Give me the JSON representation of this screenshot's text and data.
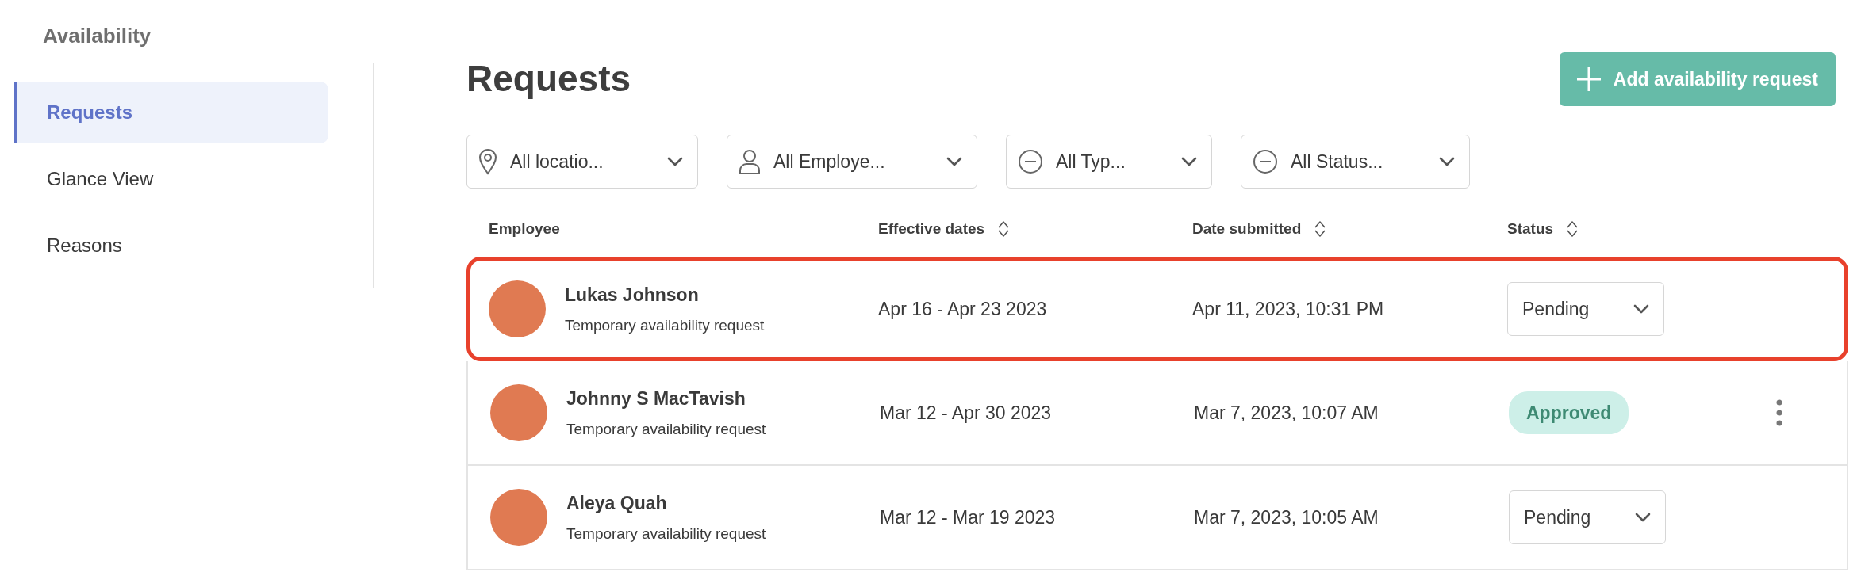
{
  "sidebar": {
    "title": "Availability",
    "items": [
      {
        "label": "Requests",
        "selected": true
      },
      {
        "label": "Glance View",
        "selected": false
      },
      {
        "label": "Reasons",
        "selected": false
      }
    ]
  },
  "header": {
    "title": "Requests",
    "add_button": "Add availability request"
  },
  "filters": [
    {
      "kind": "location",
      "label": "All locatio..."
    },
    {
      "kind": "person",
      "label": "All Employe..."
    },
    {
      "kind": "minus",
      "label": "All Typ..."
    },
    {
      "kind": "minus",
      "label": "All Status..."
    }
  ],
  "table": {
    "columns": [
      {
        "label": "Employee",
        "sortable": false
      },
      {
        "label": "Effective dates",
        "sortable": true
      },
      {
        "label": "Date submitted",
        "sortable": true
      },
      {
        "label": "Status",
        "sortable": true
      }
    ],
    "rows": [
      {
        "name": "Lukas Johnson",
        "subtitle": "Temporary availability request",
        "dates": "Apr 16 - Apr 23 2023",
        "submitted": "Apr 11, 2023, 10:31 PM",
        "status": "Pending",
        "kind": "dropdown",
        "highlighted": true,
        "menu": false
      },
      {
        "name": "Johnny S MacTavish",
        "subtitle": "Temporary availability request",
        "dates": "Mar 12 - Apr 30 2023",
        "submitted": "Mar 7, 2023, 10:07 AM",
        "status": "Approved",
        "kind": "pill",
        "highlighted": false,
        "menu": true
      },
      {
        "name": "Aleya Quah",
        "subtitle": "Temporary availability request",
        "dates": "Mar 12 - Mar 19 2023",
        "submitted": "Mar 7, 2023, 10:05 AM",
        "status": "Pending",
        "kind": "dropdown",
        "highlighted": false,
        "menu": false
      }
    ]
  }
}
